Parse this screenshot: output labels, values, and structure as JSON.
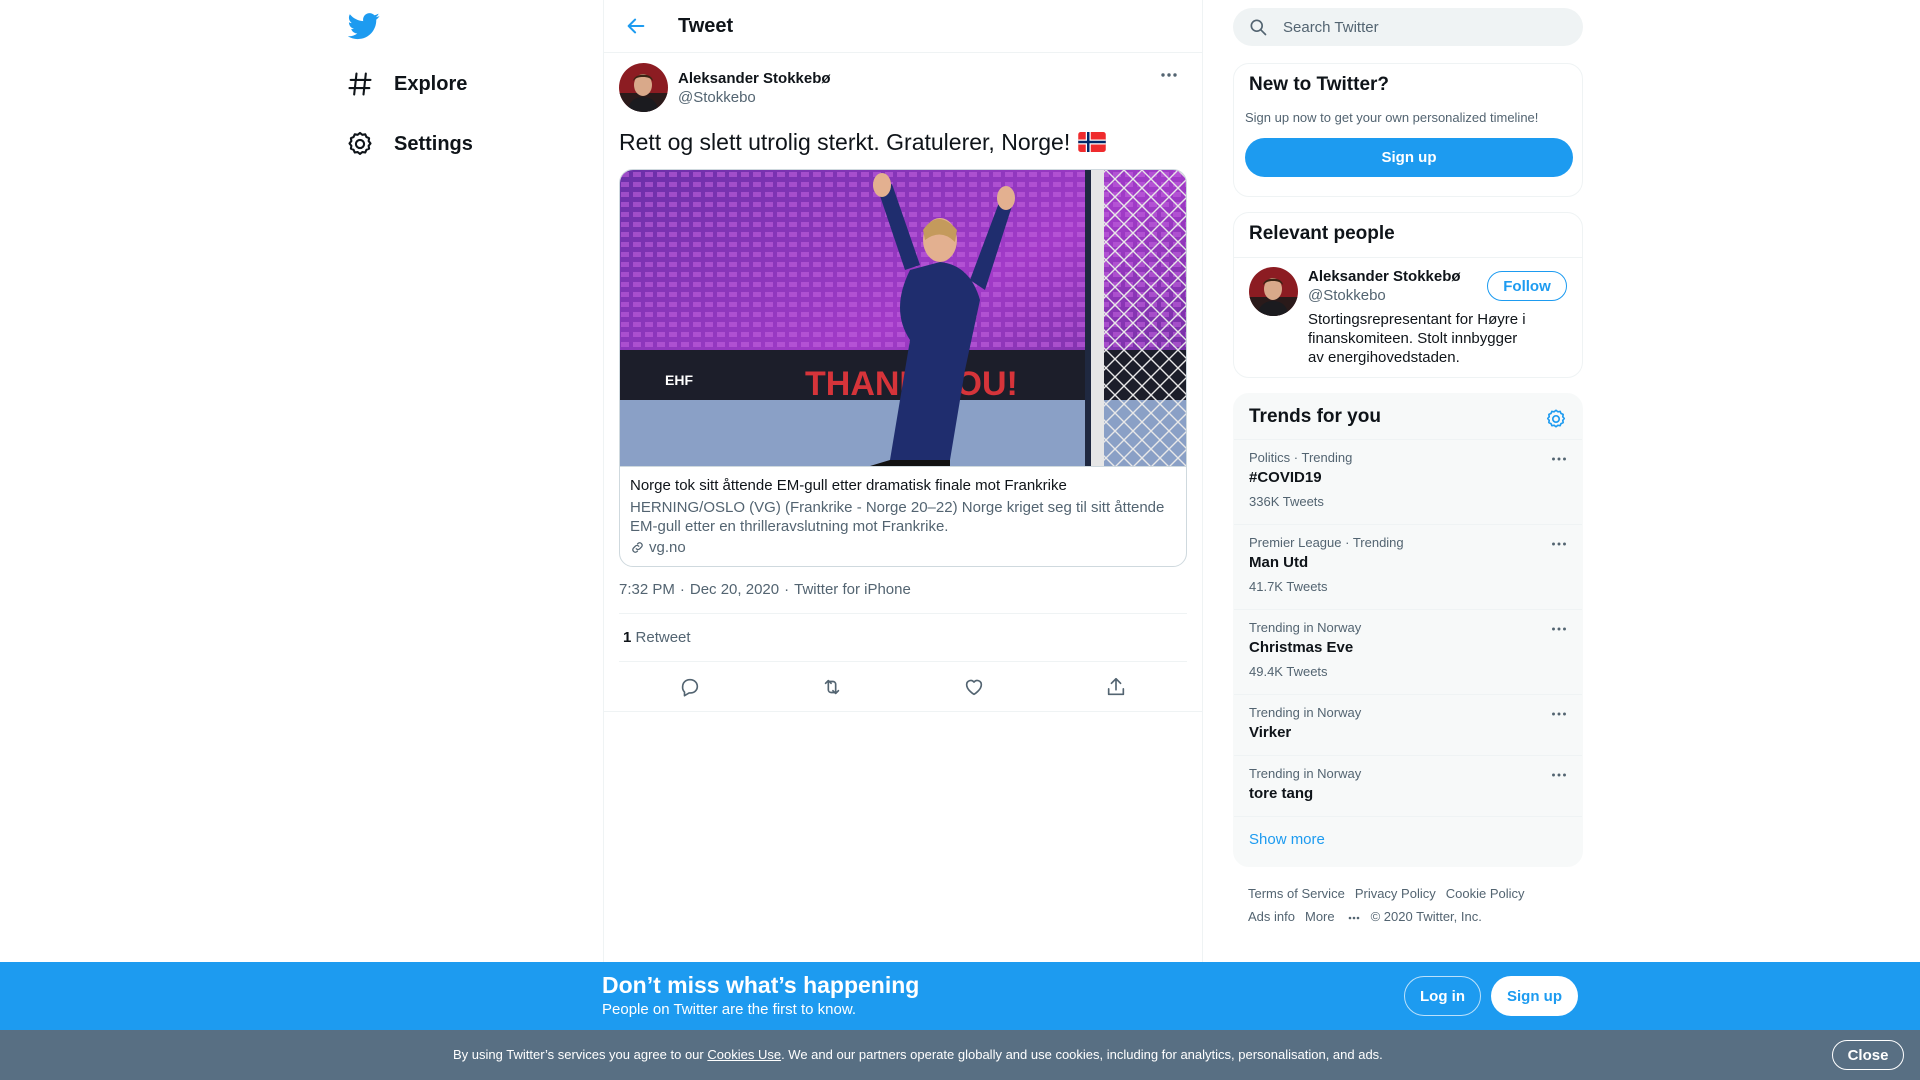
{
  "nav": {
    "items": [
      {
        "label": "Explore",
        "icon": "hashtag-icon"
      },
      {
        "label": "Settings",
        "icon": "gear-icon"
      }
    ]
  },
  "header": {
    "title": "Tweet"
  },
  "tweet": {
    "author_name": "Aleksander Stokkebø",
    "author_handle": "@Stokkebo",
    "text": "Rett og slett utrolig sterkt. Gratulerer, Norge!",
    "card": {
      "title": "Norge tok sitt åttende EM-gull etter dramatisk finale mot Frankrike",
      "description": "HERNING/OSLO (VG) (Frankrike - Norge 20–22) Norge kriget seg til sitt åttende EM-gull etter en thrilleravslutning mot Frankrike.",
      "domain": "vg.no"
    },
    "time": "7:32 PM",
    "date": "Dec 20, 2020",
    "source": "Twitter for iPhone",
    "retweet_count": "1",
    "retweet_label": "Retweet"
  },
  "search": {
    "placeholder": "Search Twitter"
  },
  "new_to_twitter": {
    "title": "New to Twitter?",
    "subtitle": "Sign up now to get your own personalized timeline!",
    "button": "Sign up"
  },
  "relevant": {
    "title": "Relevant people",
    "person": {
      "name": "Aleksander Stokkebø",
      "handle": "@Stokkebo",
      "bio": "Stortingsrepresentant for Høyre i finanskomiteen. Stolt innbygger av energihovedstaden.",
      "follow": "Follow"
    }
  },
  "trends": {
    "title": "Trends for you",
    "items": [
      {
        "context": "Politics · Trending",
        "name": "#COVID19",
        "count": "336K Tweets"
      },
      {
        "context": "Premier League · Trending",
        "name": "Man Utd",
        "count": "41.7K Tweets"
      },
      {
        "context": "Trending in Norway",
        "name": "Christmas Eve",
        "count": "49.4K Tweets"
      },
      {
        "context": "Trending in Norway",
        "name": "Virker"
      },
      {
        "context": "Trending in Norway",
        "name": "tore tang"
      }
    ],
    "show_more": "Show more"
  },
  "footer": {
    "terms": "Terms of Service",
    "privacy": "Privacy Policy",
    "cookie": "Cookie Policy",
    "ads": "Ads info",
    "more": "More",
    "copyright": "© 2020 Twitter, Inc."
  },
  "banner": {
    "title": "Don’t miss what’s happening",
    "subtitle": "People on Twitter are the first to know.",
    "login": "Log in",
    "signup": "Sign up"
  },
  "cookie": {
    "prefix": "By using Twitter’s services you agree to our",
    "link": "Cookies Use",
    "suffix": ". We and our partners operate globally and use cookies, including for analytics, personalisation, and ads.",
    "close": "Close"
  },
  "colors": {
    "accent": "#1d9bf0",
    "text": "#0f1419",
    "secondary": "#536471",
    "cookie_bar": "#586f83"
  }
}
